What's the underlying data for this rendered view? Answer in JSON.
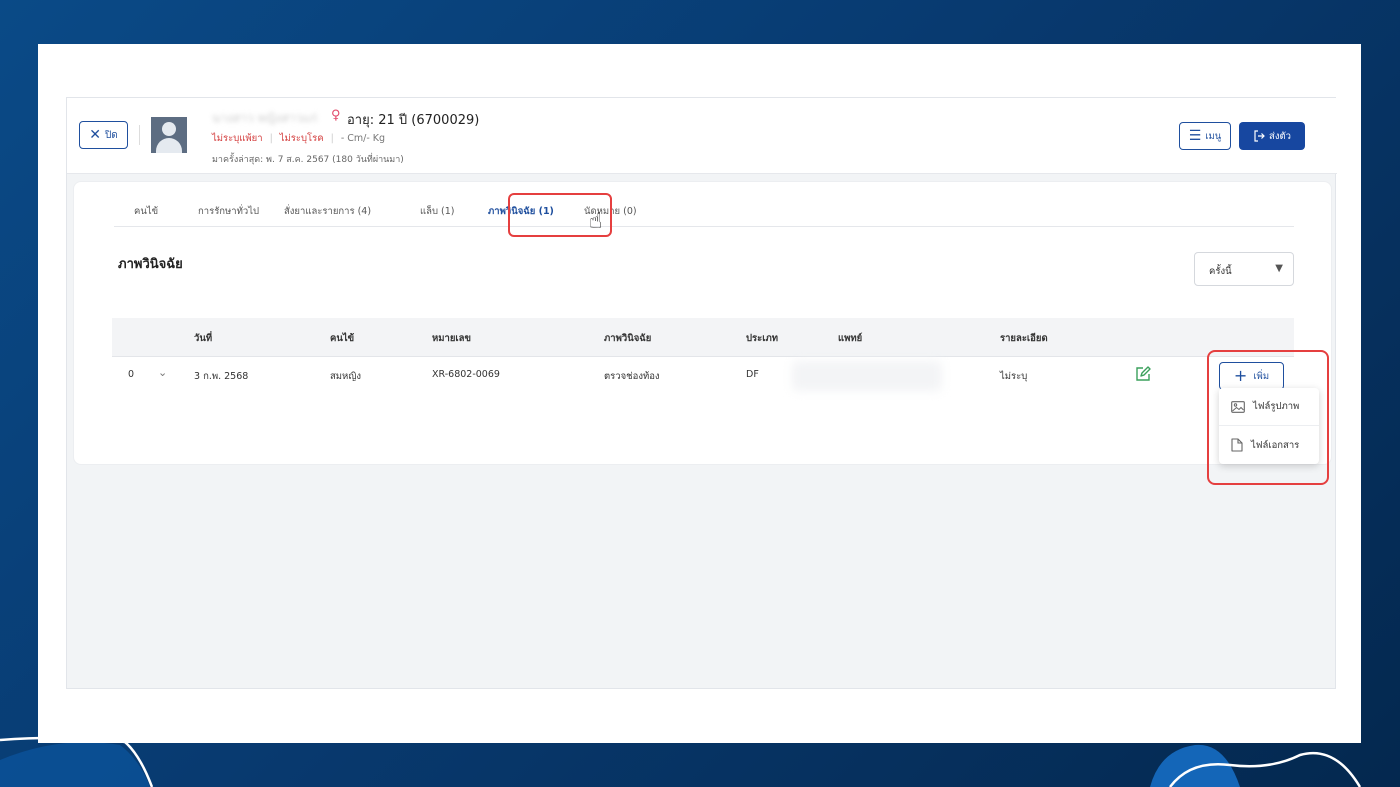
{
  "header": {
    "close_label": "ปิด",
    "patient_name": "นางสาว หญิงสาวแก่",
    "age_label": "อายุ: 21 ปี  (6700029)",
    "allergy": "ไม่ระบุแพ้ยา",
    "disease": "ไม่ระบุโรค",
    "measure": "- Cm/- Kg",
    "last_visit": "มาครั้งล่าสุด: พ. 7 ส.ค. 2567 (180 วันที่ผ่านมา)",
    "menu_label": "เมนู",
    "send_label": "ส่งตัว"
  },
  "tabs": [
    {
      "label": "คนไข้"
    },
    {
      "label": "การรักษาทั่วไป"
    },
    {
      "label": "สั่งยาและรายการ (4)"
    },
    {
      "label": "แล็บ (1)"
    },
    {
      "label": "ภาพวินิจฉัย (1)"
    },
    {
      "label": "นัดหมาย (0)"
    }
  ],
  "active_tab": "ภาพวินิจฉัย (1)",
  "section": {
    "title": "ภาพวินิจฉัย",
    "filter_value": "ครั้งนี้"
  },
  "table": {
    "columns": [
      "วันที่",
      "คนไข้",
      "หมายเลข",
      "ภาพวินิจฉัย",
      "ประเภท",
      "แพทย์",
      "รายละเอียด"
    ],
    "rows": [
      {
        "index": "0",
        "date": "3 ก.พ. 2568",
        "patient": "สมหญิง",
        "number": "XR-6802-0069",
        "diagnosis": "ตรวจช่องท้อง",
        "type": "DF",
        "doctor": "",
        "detail": "ไม่ระบุ"
      }
    ]
  },
  "add_button": {
    "label": "เพิ่ม",
    "menu": [
      {
        "label": "ไฟล์รูปภาพ",
        "icon": "image-icon"
      },
      {
        "label": "ไฟล์เอกสาร",
        "icon": "document-icon"
      }
    ]
  },
  "colors": {
    "primary": "#1747a0",
    "highlight": "#e53f3f",
    "edit": "#3aa05b"
  }
}
